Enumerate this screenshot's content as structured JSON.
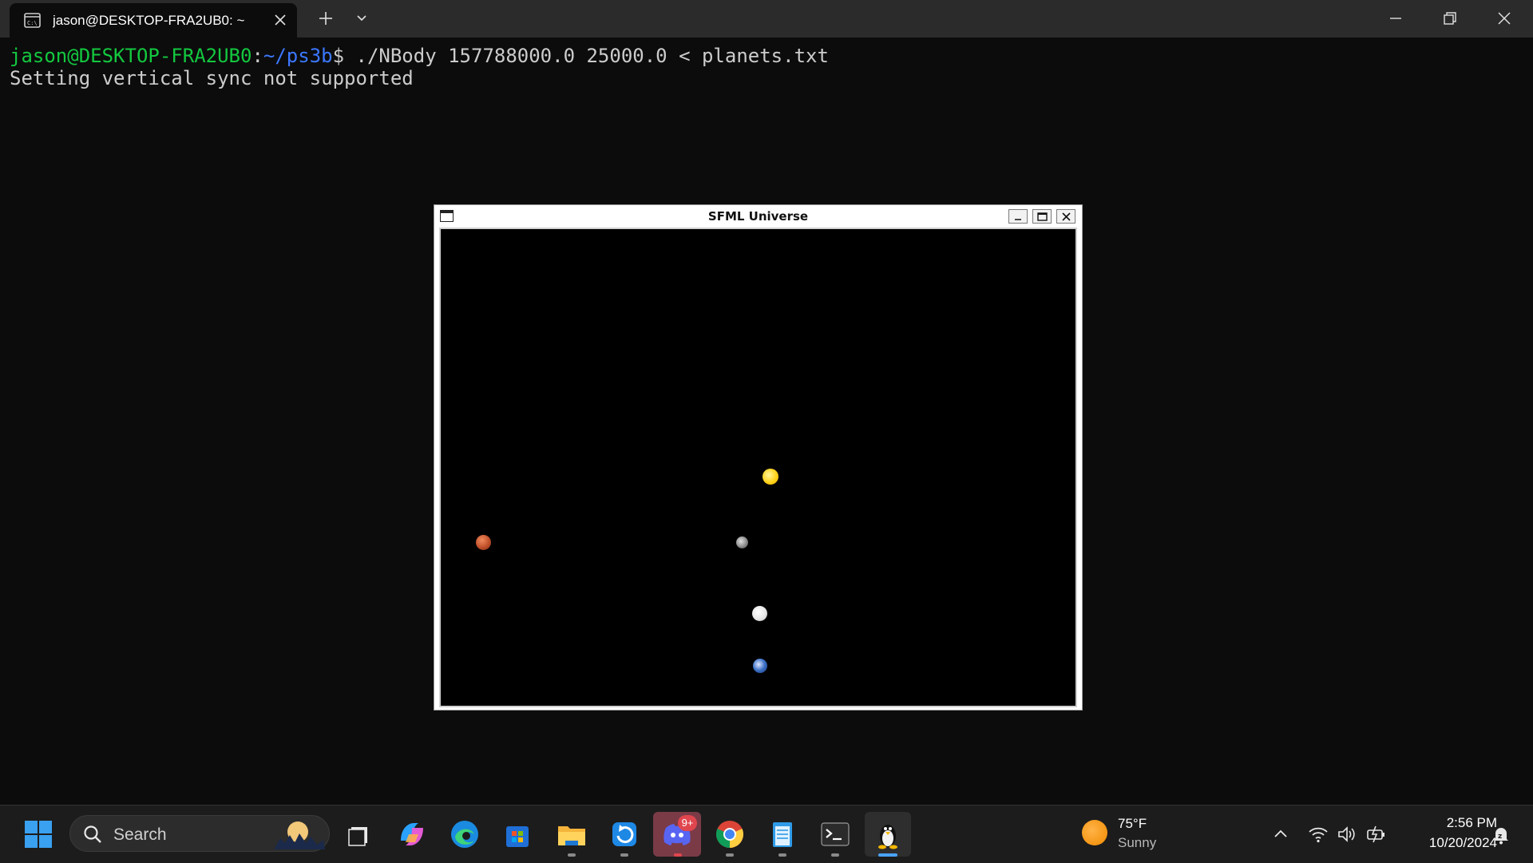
{
  "terminal": {
    "tab_title": "jason@DESKTOP-FRA2UB0: ~",
    "prompt_user": "jason@DESKTOP-FRA2UB0",
    "prompt_sep": ":",
    "prompt_path": "~/ps3b",
    "prompt_symbol": "$",
    "command": " ./NBody 157788000.0 25000.0 < planets.txt",
    "output_line": "Setting vertical sync not supported"
  },
  "sfml_window": {
    "title": "SFML Universe",
    "bodies": [
      {
        "name": "sun",
        "color": "#ffd21a"
      },
      {
        "name": "mars",
        "color": "#c0502a"
      },
      {
        "name": "mercury",
        "color": "#8c8c8c"
      },
      {
        "name": "venus",
        "color": "#f2f2f2"
      },
      {
        "name": "earth",
        "color": "#3a6fc4"
      }
    ]
  },
  "taskbar": {
    "search_label": "Search",
    "discord_badge": "9+",
    "weather_temp": "75°F",
    "weather_condition": "Sunny",
    "time": "2:56 PM",
    "date": "10/20/2024",
    "apps": [
      "start-icon",
      "task-view-icon",
      "copilot-icon",
      "edge-icon",
      "store-icon",
      "file-explorer-icon",
      "sync-icon",
      "discord-icon",
      "chrome-icon",
      "notepad-icon",
      "terminal-icon",
      "linux-tux-icon"
    ]
  }
}
